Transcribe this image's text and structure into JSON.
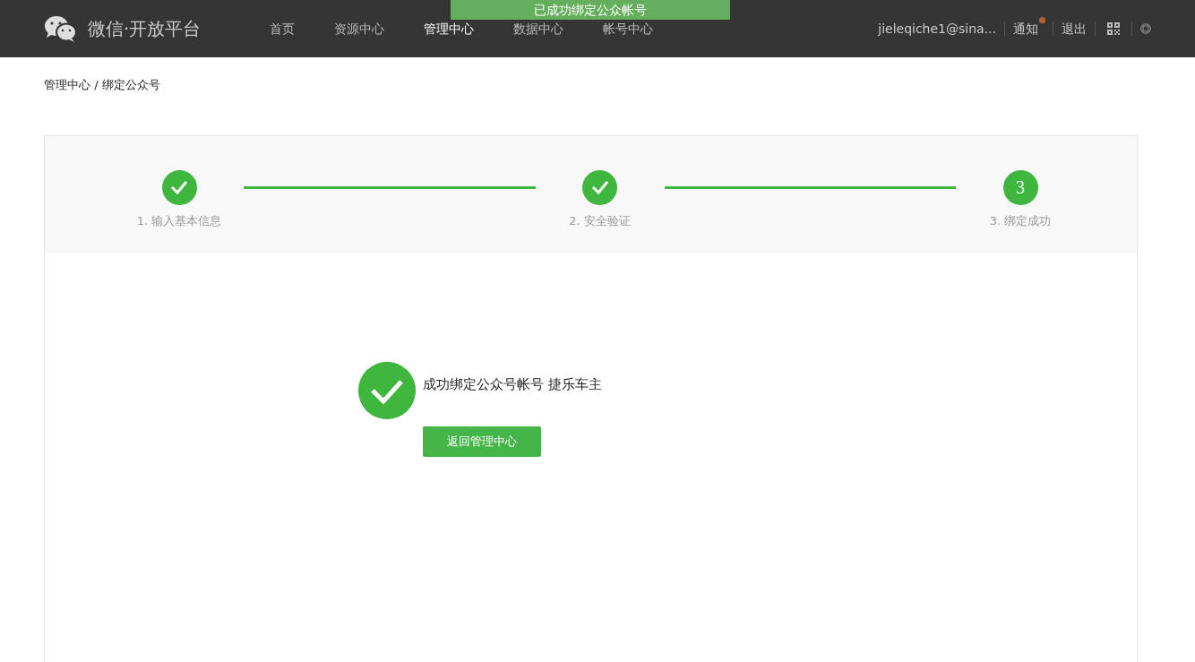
{
  "header": {
    "logo_text": "微信·开放平台",
    "nav": [
      {
        "label": "首页",
        "selected": false
      },
      {
        "label": "资源中心",
        "selected": false
      },
      {
        "label": "管理中心",
        "selected": true
      },
      {
        "label": "数据中心",
        "selected": false
      },
      {
        "label": "帐号中心",
        "selected": false
      }
    ],
    "user": "jieleqiche1@sina...",
    "notice": {
      "label": "通知",
      "unread": true
    },
    "logout": "退出"
  },
  "toast": "已成功绑定公众帐号",
  "breadcrumb": "管理中心 / 绑定公众号",
  "steps": [
    {
      "label": "1. 输入基本信息",
      "done": true
    },
    {
      "label": "2. 安全验证",
      "done": true
    },
    {
      "number": "3",
      "label": "3. 绑定成功",
      "done": false
    }
  ],
  "result": {
    "message": "成功绑定公众号帐号 捷乐车主",
    "button": "返回管理中心"
  }
}
